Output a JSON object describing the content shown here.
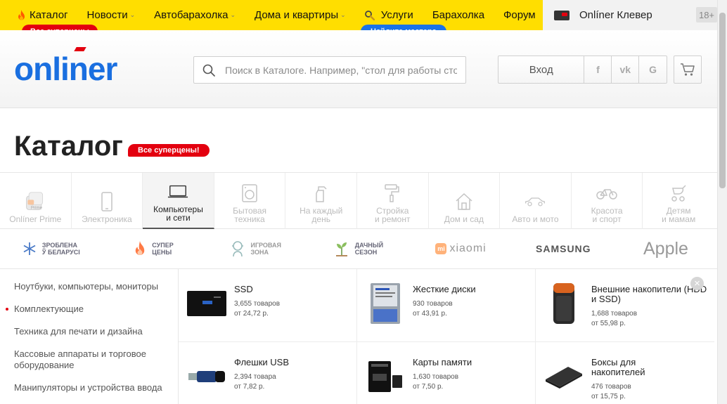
{
  "topnav": {
    "items": [
      {
        "label": "Каталог",
        "icon": "flame-icon",
        "chevron": false
      },
      {
        "label": "Новости",
        "chevron": true
      },
      {
        "label": "Автобарахолка",
        "chevron": true
      },
      {
        "label": "Дома и квартиры",
        "chevron": true
      },
      {
        "label": "Услуги",
        "icon": "wrench-icon",
        "chevron": false
      },
      {
        "label": "Барахолка",
        "chevron": false
      },
      {
        "label": "Форум",
        "chevron": false
      }
    ],
    "catalog_badge": "Все суперцены",
    "services_badge": "Найдите мастера",
    "clever_label": "Onlíner Клевер",
    "age_label": "18+"
  },
  "header": {
    "logo_text": "onliner",
    "search_placeholder": "Поиск в Каталоге. Например, \"стол для работы стоя\"",
    "login_label": "Вход",
    "social": [
      "f",
      "vk",
      "G"
    ]
  },
  "page": {
    "title": "Каталог",
    "title_badge": "Все суперцены!"
  },
  "tabs": [
    {
      "label": "Onlíner Prime",
      "icon": "prime-icon",
      "active": false
    },
    {
      "label": "Электроника",
      "icon": "phone-icon",
      "active": false
    },
    {
      "label": "Компьютеры\nи сети",
      "icon": "laptop-icon",
      "active": true
    },
    {
      "label": "Бытовая\nтехника",
      "icon": "washer-icon",
      "active": false
    },
    {
      "label": "На каждый\nдень",
      "icon": "spray-bottle-icon",
      "active": false
    },
    {
      "label": "Стройка\nи ремонт",
      "icon": "paint-roller-icon",
      "active": false
    },
    {
      "label": "Дом и сад",
      "icon": "house-icon",
      "active": false
    },
    {
      "label": "Авто и мото",
      "icon": "car-icon",
      "active": false
    },
    {
      "label": "Красота\nи спорт",
      "icon": "bicycle-icon",
      "active": false
    },
    {
      "label": "Детям\nи мамам",
      "icon": "stroller-icon",
      "active": false
    }
  ],
  "promos": [
    {
      "text": "Зроблена\nў Беларусі",
      "icon": "snowflake-icon"
    },
    {
      "text": "Супер\nцены",
      "icon": "flame-icon"
    },
    {
      "text": "Игровая\nзона",
      "icon": "gamer-icon"
    },
    {
      "text": "Дачный\nсезон",
      "icon": "sprout-icon"
    },
    {
      "text": "xiaomi",
      "icon": "xiaomi-logo"
    },
    {
      "text": "SAMSUNG",
      "icon": "samsung-logo"
    },
    {
      "text": "Apple",
      "icon": "apple-logo"
    }
  ],
  "sidebar": {
    "items": [
      {
        "label": "Ноутбуки, компьютеры, мониторы",
        "active": false
      },
      {
        "label": "Комплектующие",
        "active": true
      },
      {
        "label": "Техника для печати и дизайна",
        "active": false
      },
      {
        "label": "Кассовые аппараты и торговое оборудование",
        "active": false
      },
      {
        "label": "Манипуляторы и устройства ввода",
        "active": false
      }
    ]
  },
  "products": [
    {
      "name": "SSD",
      "count": "3,655 товаров",
      "price": "от 24,72 р.",
      "icon": "ssd-image"
    },
    {
      "name": "Жесткие диски",
      "count": "930 товаров",
      "price": "от 43,91 р.",
      "icon": "hdd-image"
    },
    {
      "name": "Внешние накопители (HDD и SSD)",
      "count": "1,688 товаров",
      "price": "от 55,98 р.",
      "icon": "external-drive-image"
    },
    {
      "name": "Флешки USB",
      "count": "2,394 товара",
      "price": "от 7,82 р.",
      "icon": "usb-flash-image"
    },
    {
      "name": "Карты памяти",
      "count": "1,630 товаров",
      "price": "от 7,50 р.",
      "icon": "memory-card-image"
    },
    {
      "name": "Боксы для накопителей",
      "count": "476 товаров",
      "price": "от 15,75 р.",
      "icon": "drive-box-image"
    }
  ],
  "colors": {
    "yellow": "#ffde00",
    "brand_blue": "#1a6fe0",
    "promo_red": "#e3000f",
    "badge_blue": "#1a73e8"
  }
}
